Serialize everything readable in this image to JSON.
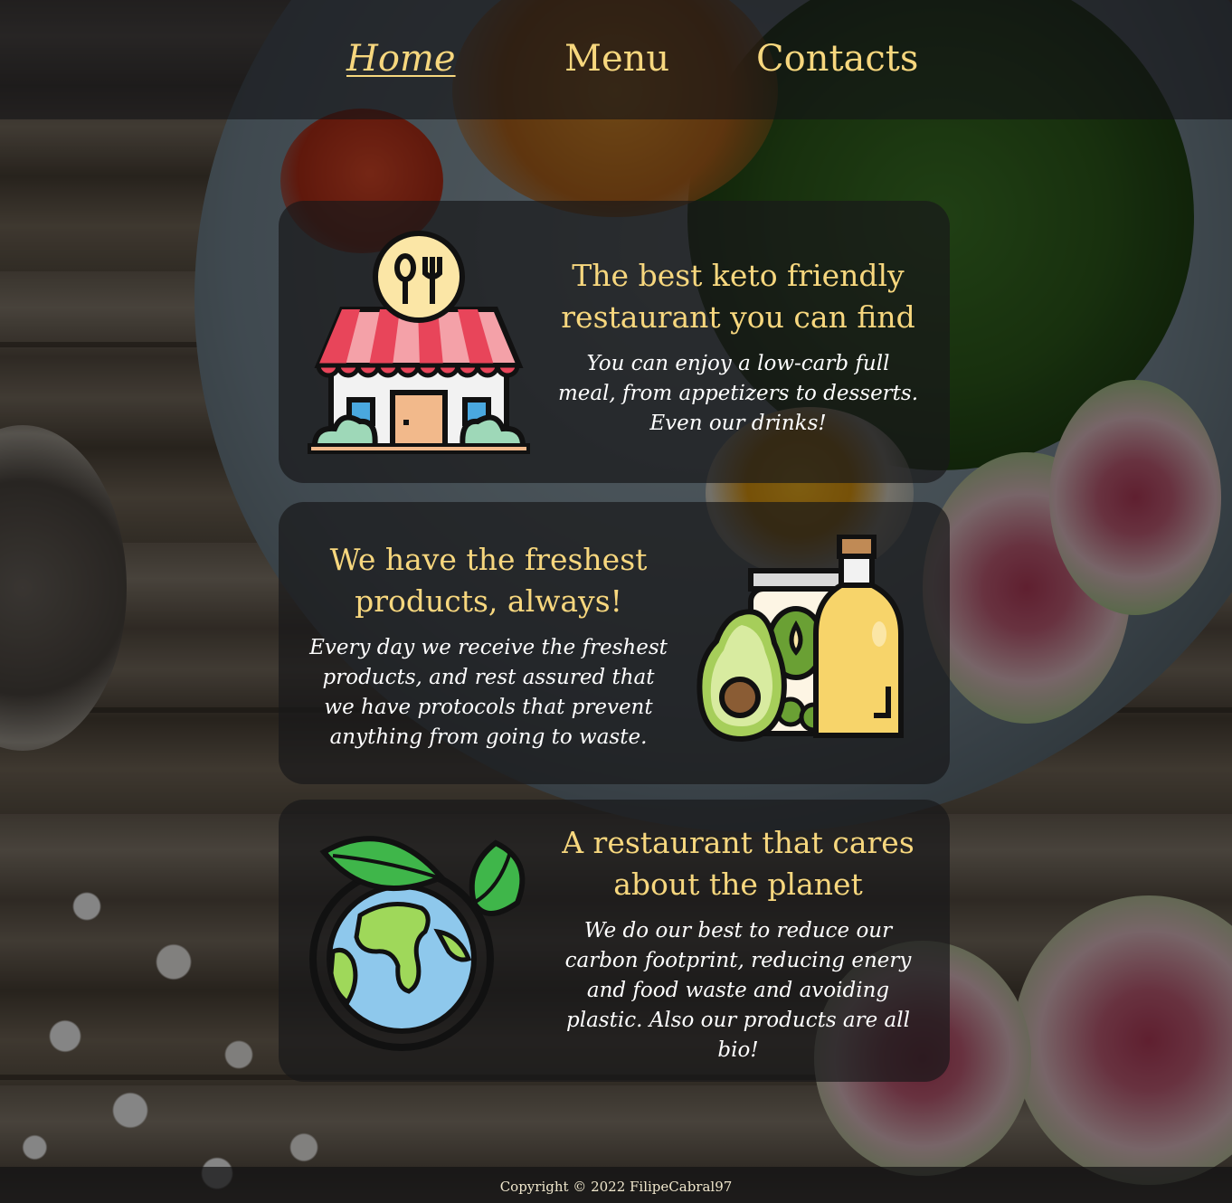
{
  "nav": {
    "items": [
      {
        "label": "Home",
        "active": true
      },
      {
        "label": "Menu",
        "active": false
      },
      {
        "label": "Contacts",
        "active": false
      }
    ]
  },
  "cards": [
    {
      "icon": "restaurant-icon",
      "title": "The best keto friendly restaurant you can find",
      "text": "You can enjoy a low-carb full meal, from appetizers to desserts. Even our drinks!"
    },
    {
      "icon": "fresh-products-icon",
      "title": "We have the freshest products, always!",
      "text": "Every day we receive the freshest products, and rest assured that we have protocols that prevent anything from going to waste."
    },
    {
      "icon": "eco-planet-icon",
      "title": "A restaurant that cares about the planet",
      "text": "We do our best to reduce our carbon footprint, reducing enery and food waste and avoiding plastic. Also our products are all bio!"
    }
  ],
  "footer": {
    "copyright": "Copyright © 2022 FilipeCabral97"
  },
  "colors": {
    "accent": "#f7d77e",
    "text": "#ffffff",
    "card_bg": "#18181a"
  }
}
